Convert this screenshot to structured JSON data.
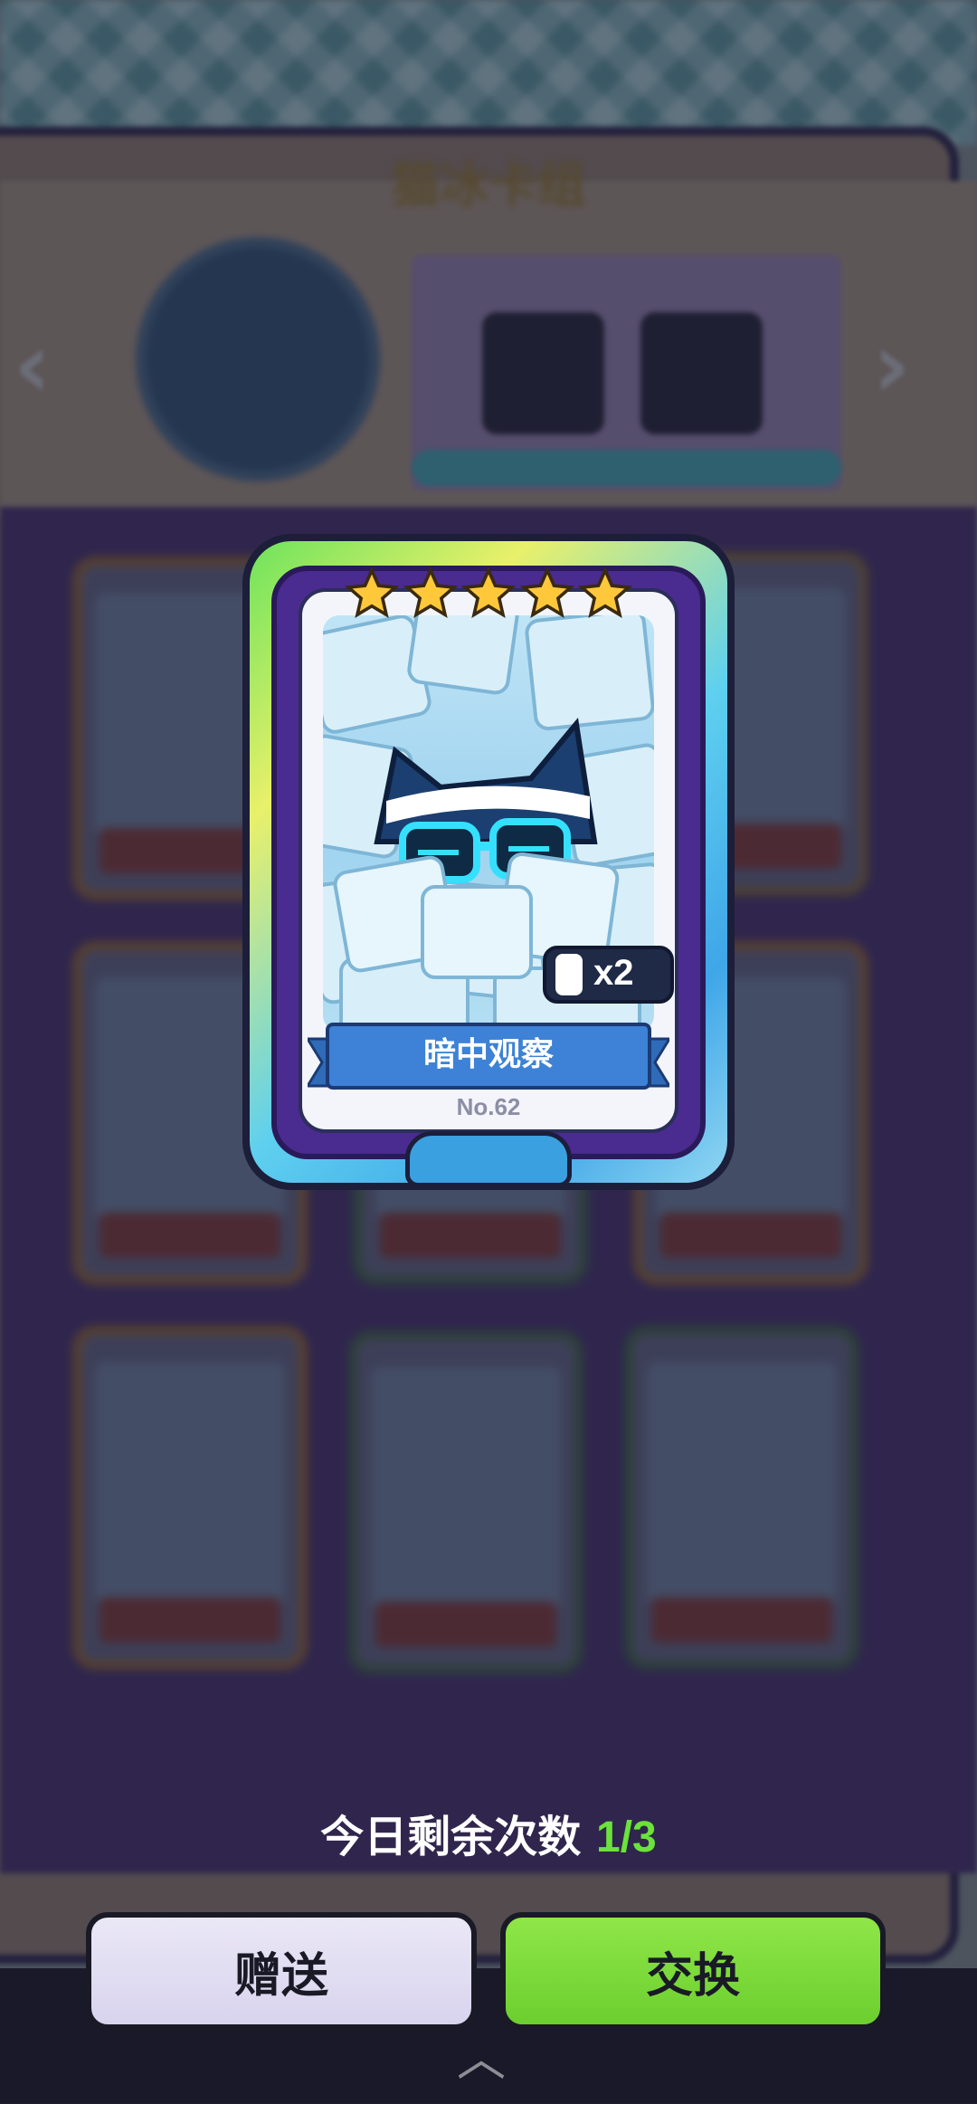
{
  "background": {
    "panel_title": "猫冰卡组"
  },
  "card": {
    "name": "暗中观察",
    "number": "No.62",
    "count": "x2",
    "stars": 5
  },
  "footer": {
    "remaining_label": "今日剩余次数",
    "remaining_count": "1/3",
    "gift_label": "赠送",
    "exchange_label": "交换"
  },
  "colors": {
    "accent_green": "#6be33a",
    "gift_button": "#e3e0f3",
    "exchange_button": "#7cd93a"
  }
}
